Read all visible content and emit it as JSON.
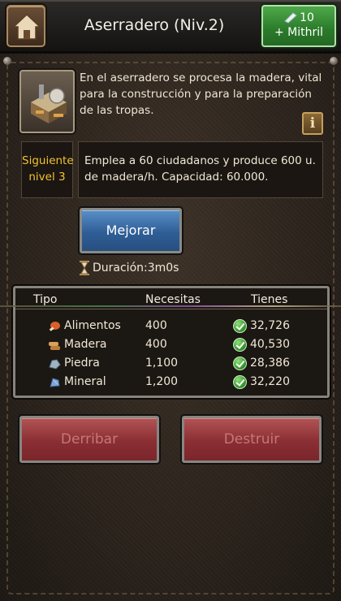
{
  "header": {
    "title": "Aserradero (Niv.2)",
    "mithril_amount": "10",
    "mithril_label": "+ Mithril"
  },
  "building": {
    "description": "En el aserradero se procesa la madera, vital para la construcción y para la preparación de las tropas.",
    "info_label": "i",
    "next_level_label": "Siguiente nivel 3",
    "next_level_text": "Emplea a 60 ciudadanos y produce 600 u. de madera/h. Capacidad: 60.000."
  },
  "actions": {
    "upgrade_label": "Mejorar",
    "duration": "Duración:3m0s",
    "demolish_label": "Derribar",
    "destroy_label": "Destruir"
  },
  "requirements": {
    "columns": [
      "Tipo",
      "Necesitas",
      "Tienes"
    ],
    "rows": [
      {
        "name": "Alimentos",
        "need": "400",
        "have": "32,726",
        "icon": "meat-icon"
      },
      {
        "name": "Madera",
        "need": "400",
        "have": "40,530",
        "icon": "wood-icon"
      },
      {
        "name": "Piedra",
        "need": "1,100",
        "have": "28,386",
        "icon": "stone-icon"
      },
      {
        "name": "Mineral",
        "need": "1,200",
        "have": "32,220",
        "icon": "ore-icon"
      }
    ]
  },
  "colors": {
    "mithril_button": "#2b7a2a",
    "upgrade_button": "#2f5e96",
    "danger_button": "#8a2e33",
    "next_level_text": "#f2c230",
    "check": "#2f8d29"
  }
}
